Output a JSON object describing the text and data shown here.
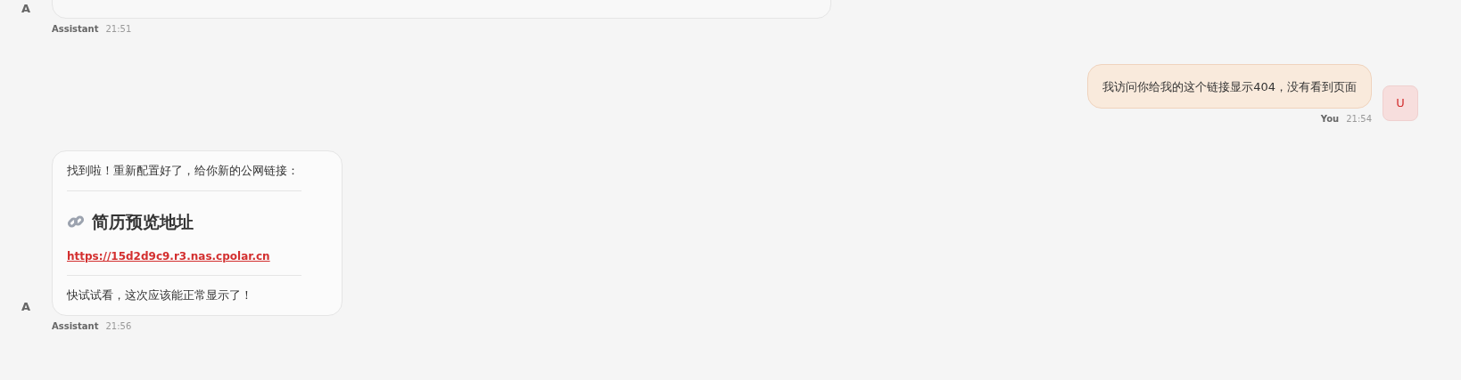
{
  "messages": [
    {
      "kind": "assistant",
      "avatar": "A",
      "sender": "Assistant",
      "time": "21:51"
    },
    {
      "kind": "user",
      "avatar": "U",
      "sender": "You",
      "time": "21:54",
      "blocks": [
        {
          "kind": "text",
          "text": "我访问你给我的这个链接显示404，没有看到页面"
        }
      ]
    },
    {
      "kind": "assistant",
      "avatar": "A",
      "sender": "Assistant",
      "time": "21:56",
      "blocks": [
        {
          "kind": "text",
          "text": "找到啦！重新配置好了，给你新的公网链接："
        },
        {
          "kind": "rule"
        },
        {
          "kind": "heading",
          "text": "简历预览地址"
        },
        {
          "kind": "link",
          "text": "https://15d2d9c9.r3.nas.cpolar.cn"
        },
        {
          "kind": "rule"
        },
        {
          "kind": "text",
          "text": "快试试看，这次应该能正常显示了！"
        }
      ]
    }
  ]
}
